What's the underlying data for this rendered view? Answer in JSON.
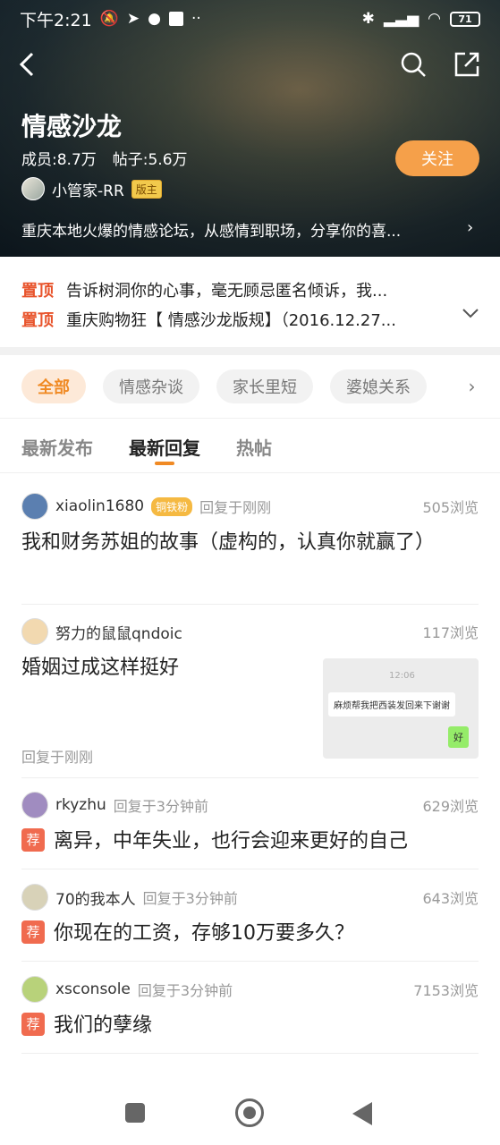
{
  "status_bar": {
    "time": "下午2:21",
    "battery": "71"
  },
  "forum": {
    "title": "情感沙龙",
    "members": "成员:8.7万",
    "posts": "帖子:5.6万",
    "follow_label": "关注",
    "moderator_name": "小管家-RR",
    "moderator_badge": "版主",
    "description": "重庆本地火爆的情感论坛，从感情到职场，分享你的喜..."
  },
  "pinned": [
    {
      "tag": "置顶",
      "text": "告诉树洞你的心事，毫无顾忌匿名倾诉，我..."
    },
    {
      "tag": "置顶",
      "text": "重庆购物狂【 情感沙龙版规】（2016.12.27..."
    }
  ],
  "categories": [
    "全部",
    "情感杂谈",
    "家长里短",
    "婆媳关系"
  ],
  "sort_tabs": [
    "最新发布",
    "最新回复",
    "热帖"
  ],
  "posts": [
    {
      "username": "xiaolin1680",
      "badge": "铜铁粉",
      "reply_time": "回复于刚刚",
      "views": "505浏览",
      "title": "我和财务苏姐的故事（虚构的，认真你就赢了）",
      "avatar_color": "#5b7fb0"
    },
    {
      "username": "努力的鼠鼠qndoic",
      "views": "117浏览",
      "title": "婚姻过成这样挺好",
      "reply_time": "回复于刚刚",
      "thumb_time": "12:06",
      "thumb_msg1": "麻烦帮我把西装发回来下谢谢",
      "thumb_msg2": "好",
      "avatar_color": "#f2d9b0"
    },
    {
      "username": "rkyzhu",
      "reply_time": "回复于3分钟前",
      "views": "629浏览",
      "rec": "荐",
      "title": "离异，中年失业，也行会迎来更好的自己",
      "avatar_color": "#a08cc0"
    },
    {
      "username": "70的我本人",
      "reply_time": "回复于3分钟前",
      "views": "643浏览",
      "rec": "荐",
      "title": "你现在的工资，存够10万要多久？",
      "avatar_color": "#d8d2b8"
    },
    {
      "username": "xsconsole",
      "reply_time": "回复于3分钟前",
      "views": "7153浏览",
      "rec": "荐",
      "title": "我们的孽缘",
      "avatar_color": "#b8d27a"
    }
  ]
}
